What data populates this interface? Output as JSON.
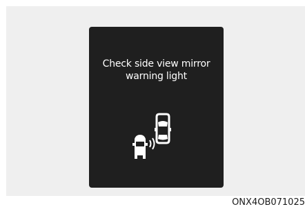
{
  "warning": {
    "line1": "Check side view mirror",
    "line2": "warning light"
  },
  "figure_code": "ONX4OB071025",
  "icons": {
    "graphic": "blind-spot-vehicles-icon"
  },
  "colors": {
    "background": "#efefef",
    "screen": "#1f1f1f",
    "text": "#ffffff"
  }
}
